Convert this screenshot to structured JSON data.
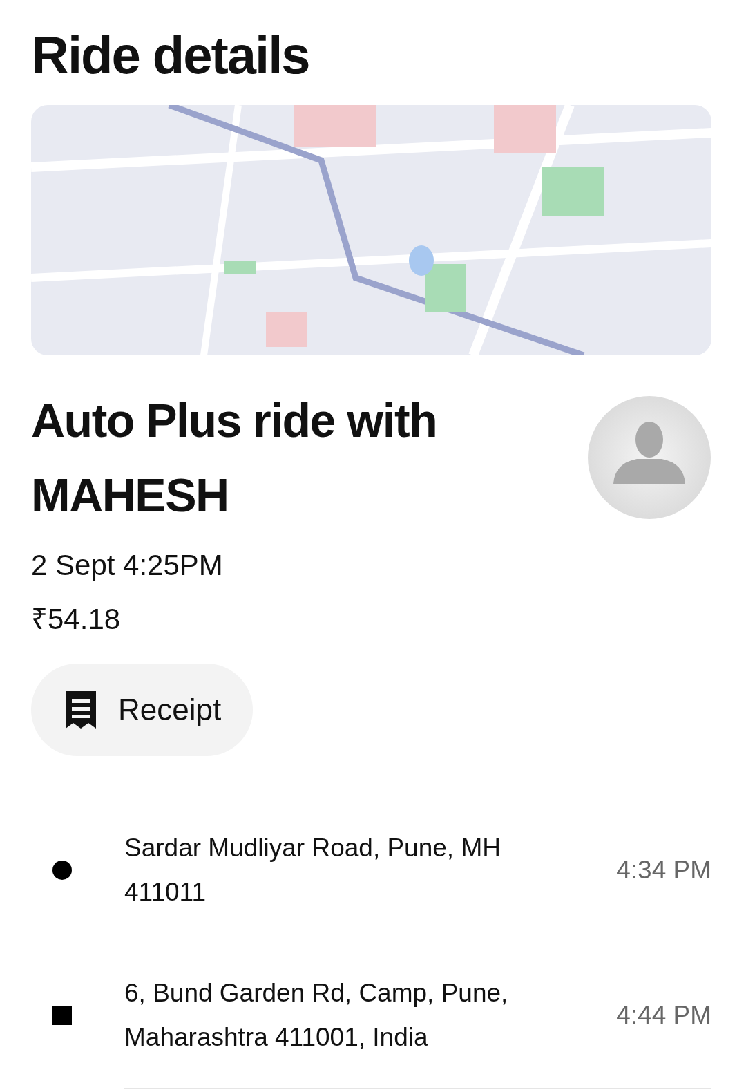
{
  "title": "Ride details",
  "ride": {
    "heading": "Auto Plus ride with MAHESH",
    "date": "2 Sept 4:25PM",
    "fare": "₹54.18"
  },
  "receipt_button": {
    "label": "Receipt"
  },
  "stops": [
    {
      "kind": "pickup",
      "address": "Sardar Mudliyar Road, Pune, MH 411011",
      "time": "4:34 PM"
    },
    {
      "kind": "dropoff",
      "address": "6, Bund Garden Rd, Camp, Pune, Maharashtra 411001, India",
      "time": "4:44 PM"
    }
  ]
}
